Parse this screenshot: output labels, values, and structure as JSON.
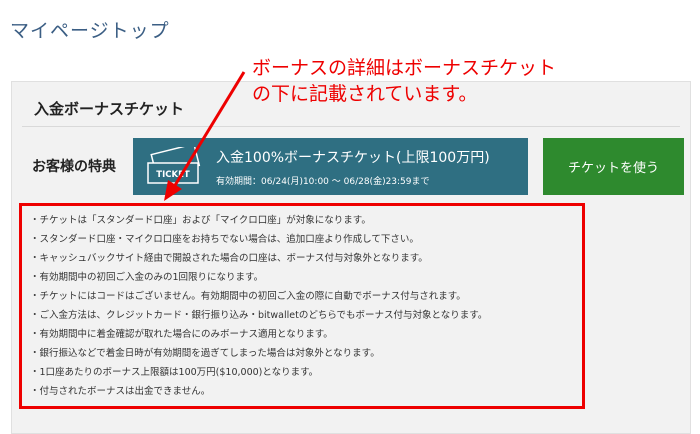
{
  "page": {
    "title": "マイページトップ"
  },
  "section": {
    "title": "入金ボーナスチケット",
    "benefit_label": "お客様の特典"
  },
  "ticket": {
    "icon_text": "TICKET",
    "title": "入金100%ボーナスチケット(上限100万円)",
    "period": "有効期間：06/24(月)10:00 ～ 06/28(金)23:59まで"
  },
  "button": {
    "label": "チケットを使う"
  },
  "notes": [
    "・チケットは「スタンダード口座」および「マイクロ口座」が対象になります。",
    "・スタンダード口座・マイクロ口座をお持ちでない場合は、追加口座より作成して下さい。",
    "・キャッシュバックサイト経由で開設された場合の口座は、ボーナス付与対象外となります。",
    "・有効期間中の初回ご入金のみの1回限りになります。",
    "・チケットにはコードはございません。有効期間中の初回ご入金の際に自動でボーナス付与されます。",
    "・ご入金方法は、クレジットカード・銀行振り込み・bitwalletのどちらでもボーナス付与対象となります。",
    "・有効期間中に着金確認が取れた場合にのみボーナス適用となります。",
    "・銀行振込などで着金日時が有効期間を過ぎてしまった場合は対象外となります。",
    "・1口座あたりのボーナス上限額は100万円($10,000)となります。",
    "・付与されたボーナスは出金できません。"
  ],
  "annotation": {
    "line1": "ボーナスの詳細はボーナスチケット",
    "line2": "の下に記載されています。"
  },
  "colors": {
    "title": "#3b5e84",
    "ticket_bg": "#2f6f82",
    "button_bg": "#2e8a2e",
    "annotation": "#ee0000"
  }
}
